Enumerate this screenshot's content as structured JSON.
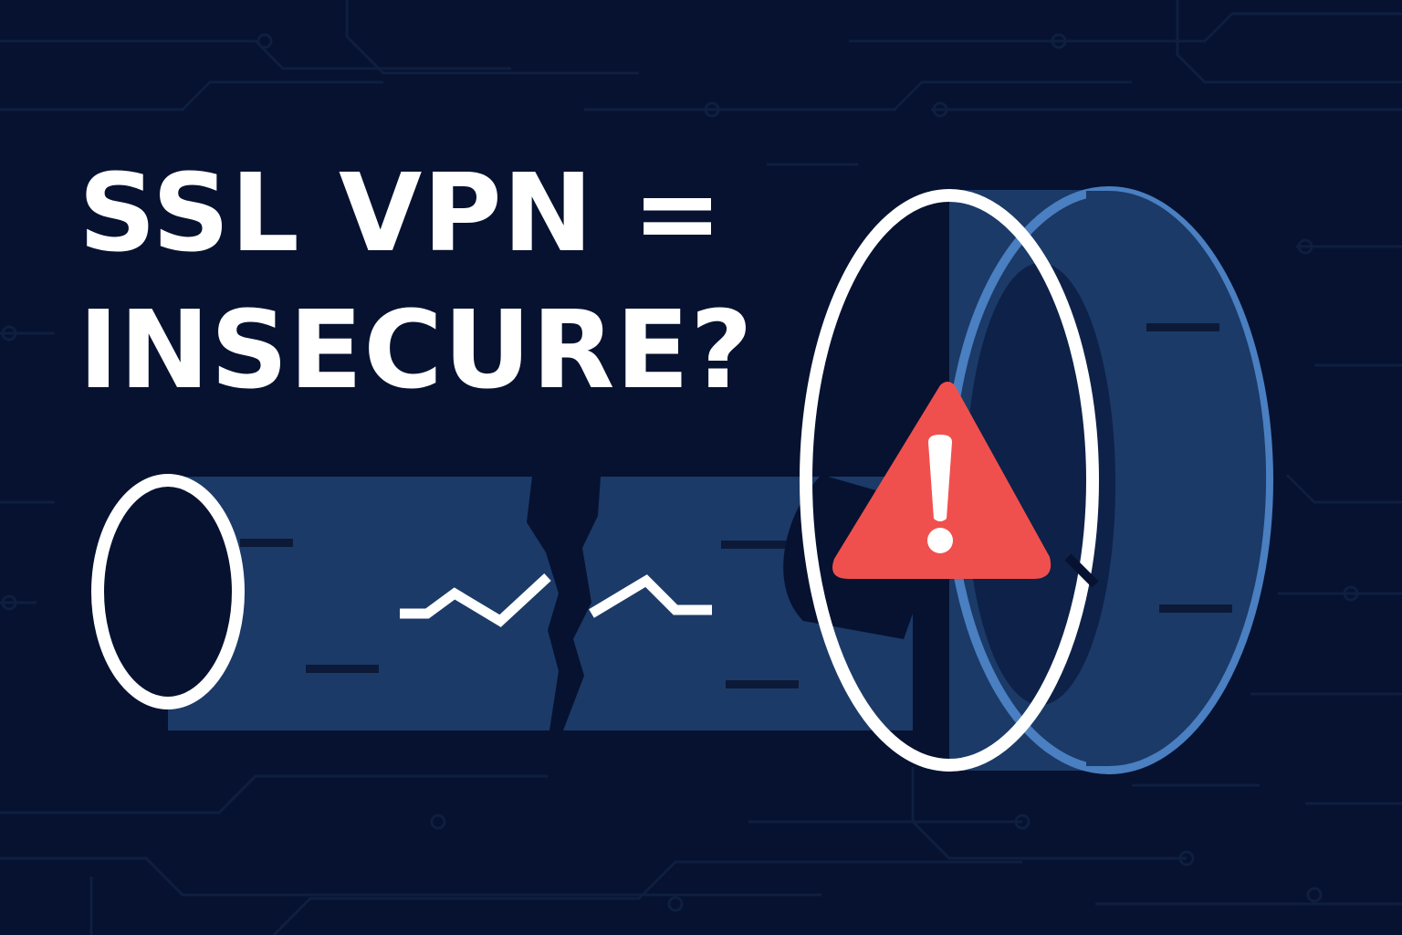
{
  "headline": {
    "line1": "SSL VPN =",
    "line2": "INSECURE?"
  },
  "colors": {
    "background": "#061230",
    "circuit": "#0f1f3f",
    "tunnel_body": "#1b3a68",
    "tunnel_rim": "#4a7fc1",
    "tunnel_dark_marks": "#0c1a38",
    "outline": "#ffffff",
    "warning": "#f0504d"
  },
  "icons": {
    "warning": "warning-triangle-icon",
    "tunnel": "broken-tunnel-illustration"
  }
}
